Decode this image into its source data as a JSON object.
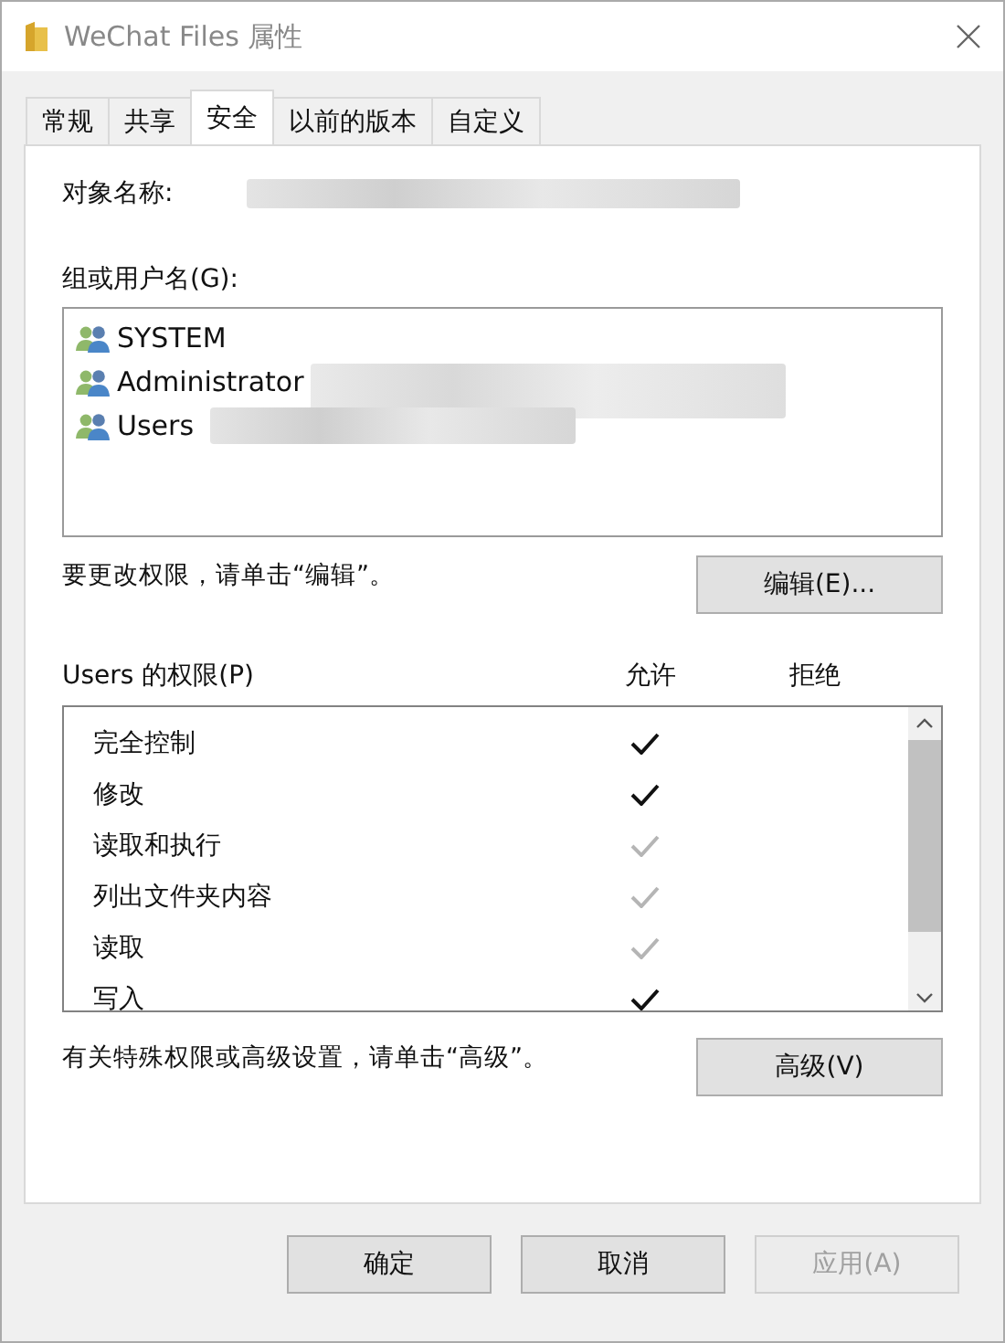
{
  "window": {
    "title": "WeChat Files 属性"
  },
  "tabs": [
    {
      "label": "常规",
      "selected": false
    },
    {
      "label": "共享",
      "selected": false
    },
    {
      "label": "安全",
      "selected": true
    },
    {
      "label": "以前的版本",
      "selected": false
    },
    {
      "label": "自定义",
      "selected": false
    }
  ],
  "object_name": {
    "label": "对象名称:"
  },
  "groups": {
    "label": "组或用户名(G):",
    "items": [
      {
        "name": "SYSTEM"
      },
      {
        "name": "Administrator"
      },
      {
        "name": "Users"
      }
    ]
  },
  "edit_hint": "要更改权限，请单击“编辑”。",
  "edit_button": "编辑(E)...",
  "permissions": {
    "label": "Users 的权限(P)",
    "allow_header": "允许",
    "deny_header": "拒绝",
    "rows": [
      {
        "name": "完全控制",
        "allow": true,
        "allow_inherited": false,
        "deny": false
      },
      {
        "name": "修改",
        "allow": true,
        "allow_inherited": false,
        "deny": false
      },
      {
        "name": "读取和执行",
        "allow": true,
        "allow_inherited": true,
        "deny": false
      },
      {
        "name": "列出文件夹内容",
        "allow": true,
        "allow_inherited": true,
        "deny": false
      },
      {
        "name": "读取",
        "allow": true,
        "allow_inherited": true,
        "deny": false
      },
      {
        "name": "写入",
        "allow": true,
        "allow_inherited": false,
        "deny": false
      }
    ]
  },
  "advanced_hint": "有关特殊权限或高级设置，请单击“高级”。",
  "advanced_button": "高级(V)",
  "buttons": [
    {
      "label": "确定",
      "disabled": false
    },
    {
      "label": "取消",
      "disabled": false
    },
    {
      "label": "应用(A)",
      "disabled": true
    }
  ]
}
